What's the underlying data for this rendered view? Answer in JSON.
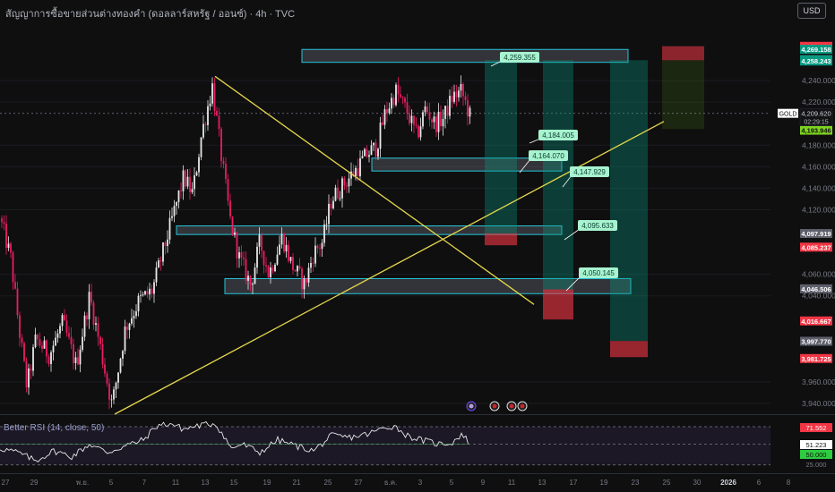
{
  "header": {
    "title": "สัญญาการซื้อขายส่วนต่างทองคำ (ดอลลาร์สหรัฐ / ออนซ์) · 4h · TVC",
    "currency": "USD"
  },
  "symbol": "GOLD",
  "countdown": "02:29:15",
  "indicator": {
    "name": "Better RSI (14, close, 50)",
    "levels": [
      "71.552",
      "51.223",
      "50.000",
      "25.000"
    ]
  },
  "chart_data": {
    "type": "candlestick",
    "ylim": [
      3930,
      4290
    ],
    "y_ticks": [
      "4,240.000",
      "4,220.000",
      "4,180.000",
      "4,160.000",
      "4,140.000",
      "4,120.000",
      "4,060.000",
      "4,040.000",
      "3,960.000",
      "3,940.000"
    ],
    "x_ticks": [
      "27",
      "29",
      "พ.ย.",
      "5",
      "7",
      "11",
      "13",
      "15",
      "19",
      "21",
      "25",
      "27",
      "ธ.ค.",
      "3",
      "5",
      "9",
      "11",
      "13",
      "17",
      "19",
      "23",
      "25",
      "30",
      "2026",
      "6",
      "8"
    ],
    "last_price": "4,209.620",
    "axis_tags": [
      {
        "value": "4,271.890",
        "color": "#f23645"
      },
      {
        "value": "4,269.158",
        "color": "#089981"
      },
      {
        "value": "4,259.531",
        "color": "#5d606b"
      },
      {
        "value": "4,259.469",
        "color": "#089981"
      },
      {
        "value": "4,258.243",
        "color": "#089981"
      },
      {
        "value": "4,197.405",
        "color": "#d8d83a"
      },
      {
        "value": "4,193.946",
        "color": "#7ed321"
      },
      {
        "value": "4,097.919",
        "color": "#5d606b"
      },
      {
        "value": "4,085.237",
        "color": "#f23645"
      },
      {
        "value": "4,046.506",
        "color": "#5d606b"
      },
      {
        "value": "4,016.667",
        "color": "#f23645"
      },
      {
        "value": "3,997.770",
        "color": "#5d606b"
      },
      {
        "value": "3,981.725",
        "color": "#f23645"
      }
    ],
    "callouts": [
      "4,259.355",
      "4,184.005",
      "4,164.070",
      "4,147.929",
      "4,095.633",
      "4,050.145"
    ]
  }
}
